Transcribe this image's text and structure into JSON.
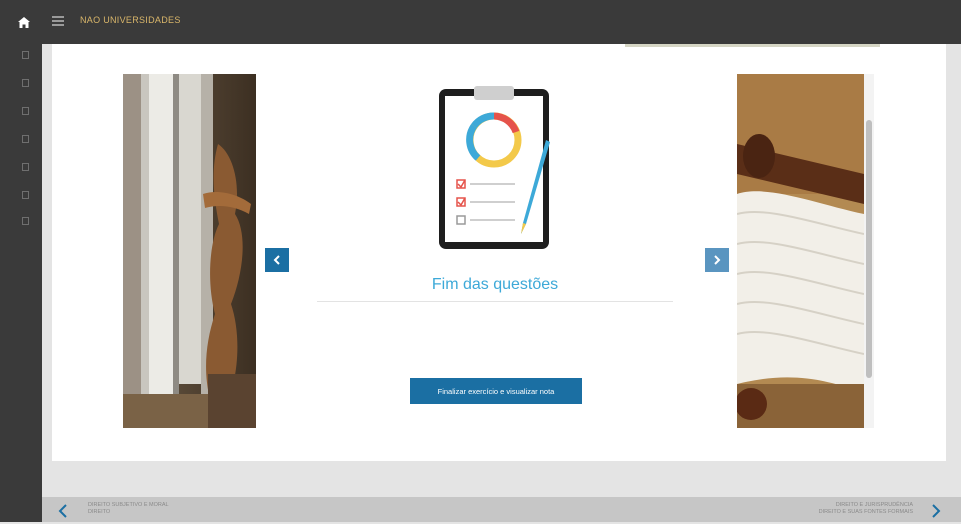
{
  "header": {
    "brand": "NAO UNIVERSIDADES",
    "home_icon": "home-icon",
    "menu_icon": "hamburger-icon"
  },
  "sidebar": {
    "items": [
      "doc-icon",
      "doc-icon",
      "doc-icon",
      "doc-icon",
      "doc-icon",
      "doc-icon",
      "doc-icon"
    ]
  },
  "main": {
    "end_title": "Fim das questões",
    "finish_button": "Finalizar exercício e visualizar nota",
    "prev_icon": "chevron-left-icon",
    "next_icon": "chevron-right-icon"
  },
  "footer": {
    "prev_title": "DIREITO SUBJETIVO E MORAL",
    "prev_subtitle": "DIREITO",
    "next_title": "DIREITO E JURISPRUDÊNCIA",
    "next_subtitle": "DIREITO E SUAS FONTES FORMAIS"
  },
  "colors": {
    "topbar": "#3a3a3a",
    "brand": "#d9b66a",
    "accent_blue": "#1b6fa3",
    "title_blue": "#3da9d8"
  }
}
